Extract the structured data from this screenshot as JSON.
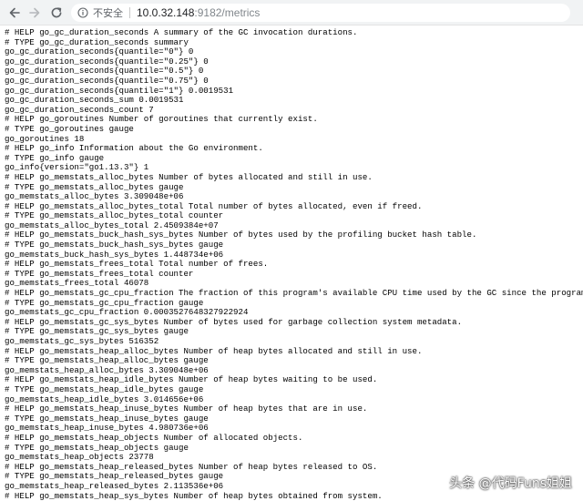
{
  "browser": {
    "security_label": "不安全",
    "url_host": "10.0.32.148",
    "url_path": ":9182/metrics"
  },
  "metrics_lines": [
    "# HELP go_gc_duration_seconds A summary of the GC invocation durations.",
    "# TYPE go_gc_duration_seconds summary",
    "go_gc_duration_seconds{quantile=\"0\"} 0",
    "go_gc_duration_seconds{quantile=\"0.25\"} 0",
    "go_gc_duration_seconds{quantile=\"0.5\"} 0",
    "go_gc_duration_seconds{quantile=\"0.75\"} 0",
    "go_gc_duration_seconds{quantile=\"1\"} 0.0019531",
    "go_gc_duration_seconds_sum 0.0019531",
    "go_gc_duration_seconds_count 7",
    "# HELP go_goroutines Number of goroutines that currently exist.",
    "# TYPE go_goroutines gauge",
    "go_goroutines 18",
    "# HELP go_info Information about the Go environment.",
    "# TYPE go_info gauge",
    "go_info{version=\"go1.13.3\"} 1",
    "# HELP go_memstats_alloc_bytes Number of bytes allocated and still in use.",
    "# TYPE go_memstats_alloc_bytes gauge",
    "go_memstats_alloc_bytes 3.309048e+06",
    "# HELP go_memstats_alloc_bytes_total Total number of bytes allocated, even if freed.",
    "# TYPE go_memstats_alloc_bytes_total counter",
    "go_memstats_alloc_bytes_total 2.4509384e+07",
    "# HELP go_memstats_buck_hash_sys_bytes Number of bytes used by the profiling bucket hash table.",
    "# TYPE go_memstats_buck_hash_sys_bytes gauge",
    "go_memstats_buck_hash_sys_bytes 1.448734e+06",
    "# HELP go_memstats_frees_total Total number of frees.",
    "# TYPE go_memstats_frees_total counter",
    "go_memstats_frees_total 46078",
    "# HELP go_memstats_gc_cpu_fraction The fraction of this program's available CPU time used by the GC since the program started.",
    "# TYPE go_memstats_gc_cpu_fraction gauge",
    "go_memstats_gc_cpu_fraction 0.0003527648327922924",
    "# HELP go_memstats_gc_sys_bytes Number of bytes used for garbage collection system metadata.",
    "# TYPE go_memstats_gc_sys_bytes gauge",
    "go_memstats_gc_sys_bytes 516352",
    "# HELP go_memstats_heap_alloc_bytes Number of heap bytes allocated and still in use.",
    "# TYPE go_memstats_heap_alloc_bytes gauge",
    "go_memstats_heap_alloc_bytes 3.309048e+06",
    "# HELP go_memstats_heap_idle_bytes Number of heap bytes waiting to be used.",
    "# TYPE go_memstats_heap_idle_bytes gauge",
    "go_memstats_heap_idle_bytes 3.014656e+06",
    "# HELP go_memstats_heap_inuse_bytes Number of heap bytes that are in use.",
    "# TYPE go_memstats_heap_inuse_bytes gauge",
    "go_memstats_heap_inuse_bytes 4.980736e+06",
    "# HELP go_memstats_heap_objects Number of allocated objects.",
    "# TYPE go_memstats_heap_objects gauge",
    "go_memstats_heap_objects 23778",
    "# HELP go_memstats_heap_released_bytes Number of heap bytes released to OS.",
    "# TYPE go_memstats_heap_released_bytes gauge",
    "go_memstats_heap_released_bytes 2.113536e+06",
    "# HELP go_memstats_heap_sys_bytes Number of heap bytes obtained from system."
  ],
  "watermark": "头条 @代码Funs姐姐",
  "icons": {
    "back": "arrow-left-icon",
    "forward": "arrow-right-icon",
    "reload": "reload-icon",
    "info": "info-circle-icon"
  },
  "colors": {
    "toolbar_bg": "#f1f3f4",
    "text": "#000000",
    "url_path": "#80868b"
  }
}
